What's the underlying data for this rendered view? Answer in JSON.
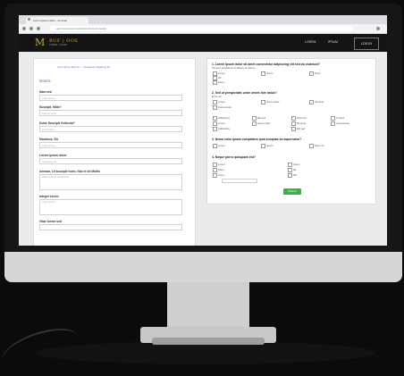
{
  "browser": {
    "tab_title": "Lorem ipsum dolor - sit amet",
    "url": "app.lorem-ipsum.com/form/contact-details"
  },
  "site": {
    "logo_mark": "M",
    "logo_text": "BUF | OOS",
    "logo_sub": "LOREM · IPSUM",
    "nav": [
      "LOREM",
      "IPSUM"
    ],
    "cta": "LOG IN"
  },
  "left_form": {
    "link_line": "Lorem ipsum dolor sit — Consectetur adipiscing elit",
    "section_title": "Mauris",
    "fields": [
      {
        "label": "Nam nisl",
        "placeholder": "Lorem ipsum"
      },
      {
        "label": "Suscipit, Nibh?",
        "placeholder": "Dolor sit amet"
      },
      {
        "label": "Dolor Suscipit Vehicula?",
        "placeholder": "Consectetur"
      },
      {
        "label": "Maximus, Sit",
        "placeholder": "Lorem ipsum"
      },
      {
        "label": "Lorem ipsum dolor",
        "placeholder": "Adipiscing elit"
      },
      {
        "label": "Aenean, Ut suscipit fuem, Nisl et sit Mollis",
        "placeholder": "Dolor sit amet consectetur"
      },
      {
        "label": "Integer lorem",
        "placeholder": "Lorem ipsum"
      },
      {
        "label": "Vitae lorem sed",
        "placeholder": ""
      }
    ]
  },
  "right_form": {
    "q1": "1. Lorem ipsum dolor sit amet consectetur adipiscing elit sed do eiusmod?",
    "q1_sub": "Tempor incididunt ut labore et dolore",
    "q1_opts": [
      "Lorem",
      "Ipsum",
      "Dolor",
      "Sit",
      "Amet"
    ],
    "q2": "2. Sed ut perspiciatis unde omnis iste natus?",
    "q2_sub": "Error sit",
    "q2_opts": [
      "Lorem",
      "Ipsum dolor",
      "Sit amet",
      "Consectetur",
      "Adipiscing",
      "Elit sed",
      "Eiusmod",
      "Tempor"
    ],
    "q3": "3. Nemo enim ipsam voluptatem quia voluptas sit aspernatur?",
    "q3_opts": [
      "Lorem",
      "Ipsum",
      "Dolor sit"
    ],
    "q4": "4. Neque porro quisquam est?",
    "q4_opts": [
      "Lorem",
      "Ipsum",
      "Dolor",
      "Sit",
      "Amet",
      "Elit"
    ],
    "submit": "Submit"
  }
}
